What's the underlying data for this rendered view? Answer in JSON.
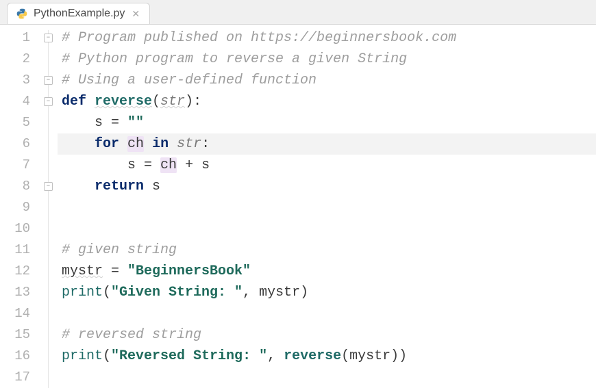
{
  "tab": {
    "filename": "PythonExample.py",
    "icon": "python-file-icon"
  },
  "editor": {
    "current_line": 6,
    "fold_markers": [
      {
        "line": 1,
        "type": "open"
      },
      {
        "line": 3,
        "type": "close"
      },
      {
        "line": 4,
        "type": "open"
      },
      {
        "line": 8,
        "type": "close"
      }
    ],
    "highlighted_identifier": "ch",
    "lines": [
      {
        "n": 1,
        "tokens": [
          {
            "t": "# Program published on https://beginnersbook.com",
            "c": "tok-comment"
          }
        ]
      },
      {
        "n": 2,
        "tokens": [
          {
            "t": "# Python program to reverse a given String",
            "c": "tok-comment"
          }
        ]
      },
      {
        "n": 3,
        "tokens": [
          {
            "t": "# Using a user-defined function",
            "c": "tok-comment"
          }
        ]
      },
      {
        "n": 4,
        "tokens": [
          {
            "t": "def ",
            "c": "tok-kw"
          },
          {
            "t": "reverse",
            "c": "tok-fn underline-wavy"
          },
          {
            "t": "(",
            "c": "tok-op"
          },
          {
            "t": "str",
            "c": "tok-param underline-wavy"
          },
          {
            "t": "):",
            "c": "tok-op"
          }
        ]
      },
      {
        "n": 5,
        "tokens": [
          {
            "t": "    s ",
            "c": "tok-ident"
          },
          {
            "t": "= ",
            "c": "tok-op"
          },
          {
            "t": "\"\"",
            "c": "tok-str"
          }
        ]
      },
      {
        "n": 6,
        "tokens": [
          {
            "t": "    ",
            "c": ""
          },
          {
            "t": "for ",
            "c": "tok-kw"
          },
          {
            "t": "ch",
            "c": "tok-ident hl-occur"
          },
          {
            "t": " ",
            "c": ""
          },
          {
            "t": "in ",
            "c": "tok-kw"
          },
          {
            "t": "str",
            "c": "tok-param"
          },
          {
            "t": ":",
            "c": "tok-op"
          }
        ]
      },
      {
        "n": 7,
        "tokens": [
          {
            "t": "        s ",
            "c": "tok-ident"
          },
          {
            "t": "= ",
            "c": "tok-op"
          },
          {
            "t": "ch",
            "c": "tok-ident hl-occur"
          },
          {
            "t": " + s",
            "c": "tok-ident"
          }
        ]
      },
      {
        "n": 8,
        "tokens": [
          {
            "t": "    ",
            "c": ""
          },
          {
            "t": "return ",
            "c": "tok-kw"
          },
          {
            "t": "s",
            "c": "tok-ident"
          }
        ]
      },
      {
        "n": 9,
        "tokens": []
      },
      {
        "n": 10,
        "tokens": []
      },
      {
        "n": 11,
        "tokens": [
          {
            "t": "# given string",
            "c": "tok-comment"
          }
        ]
      },
      {
        "n": 12,
        "tokens": [
          {
            "t": "mystr",
            "c": "tok-ident underline-wavy"
          },
          {
            "t": " = ",
            "c": "tok-op"
          },
          {
            "t": "\"BeginnersBook\"",
            "c": "tok-str"
          }
        ]
      },
      {
        "n": 13,
        "tokens": [
          {
            "t": "print",
            "c": "tok-builtin"
          },
          {
            "t": "(",
            "c": "tok-op"
          },
          {
            "t": "\"Given String: \"",
            "c": "tok-str"
          },
          {
            "t": ", mystr)",
            "c": "tok-ident"
          }
        ]
      },
      {
        "n": 14,
        "tokens": []
      },
      {
        "n": 15,
        "tokens": [
          {
            "t": "# reversed string",
            "c": "tok-comment"
          }
        ]
      },
      {
        "n": 16,
        "tokens": [
          {
            "t": "print",
            "c": "tok-builtin"
          },
          {
            "t": "(",
            "c": "tok-op"
          },
          {
            "t": "\"Reversed String: \"",
            "c": "tok-str"
          },
          {
            "t": ", ",
            "c": "tok-op"
          },
          {
            "t": "reverse",
            "c": "tok-fn"
          },
          {
            "t": "(mystr))",
            "c": "tok-ident"
          }
        ]
      },
      {
        "n": 17,
        "tokens": []
      }
    ]
  }
}
